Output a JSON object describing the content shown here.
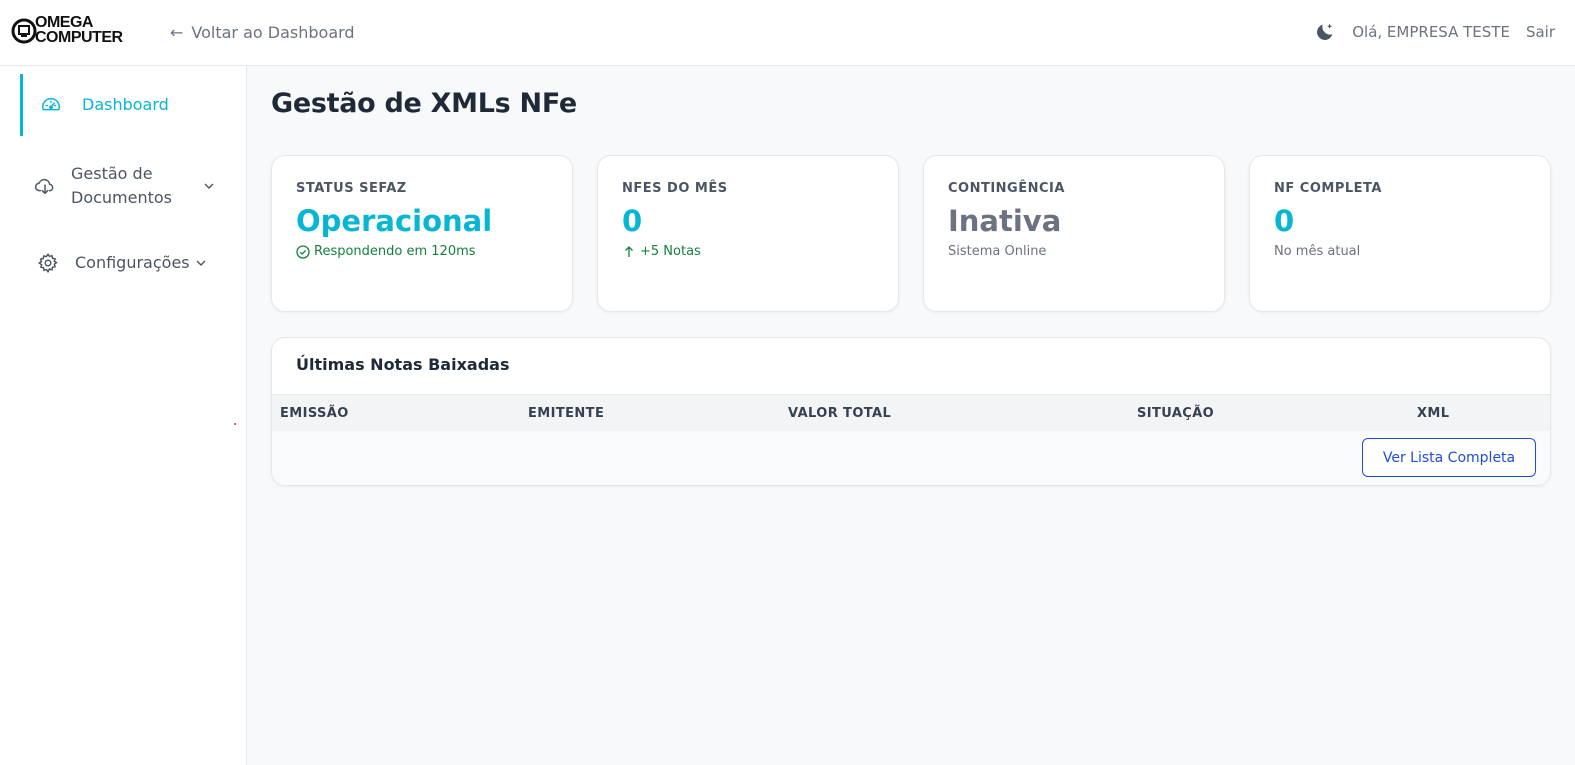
{
  "header": {
    "logo_text_line1": "OMEGA",
    "logo_text_line2": "COMPUTER",
    "back_label": "Voltar ao Dashboard",
    "greeting": "Olá, EMPRESA TESTE",
    "logout_label": "Sair",
    "theme_icon": "moon-icon"
  },
  "sidebar": {
    "items": [
      {
        "label": "Dashboard",
        "icon": "gauge-icon",
        "active": true
      },
      {
        "label": "Gestão de Documentos",
        "icon": "cloud-download-icon",
        "expandable": true
      },
      {
        "label": "Configurações",
        "icon": "gear-icon",
        "expandable": true
      }
    ]
  },
  "main": {
    "title": "Gestão de XMLs NFe",
    "cards": [
      {
        "label": "STATUS SEFAZ",
        "value": "Operacional",
        "sub": "Respondendo em 120ms",
        "sub_icon": "check-circle-icon"
      },
      {
        "label": "NFES DO MÊS",
        "value": "0",
        "sub": "+5 Notas",
        "sub_icon": "arrow-up-icon"
      },
      {
        "label": "CONTINGÊNCIA",
        "value": "Inativa",
        "sub": "Sistema Online"
      },
      {
        "label": "NF COMPLETA",
        "value": "0",
        "sub": "No mês atual"
      }
    ],
    "table": {
      "title": "Últimas Notas Baixadas",
      "columns": [
        "EMISSÃO",
        "EMITENTE",
        "VALOR TOTAL",
        "SITUAÇÃO",
        "XML"
      ],
      "rows": [],
      "button_label": "Ver Lista Completa"
    }
  },
  "colors": {
    "accent": "#06b6d4",
    "success": "#15803d",
    "link_blue": "#1d4ed8",
    "muted": "#6b7280"
  }
}
